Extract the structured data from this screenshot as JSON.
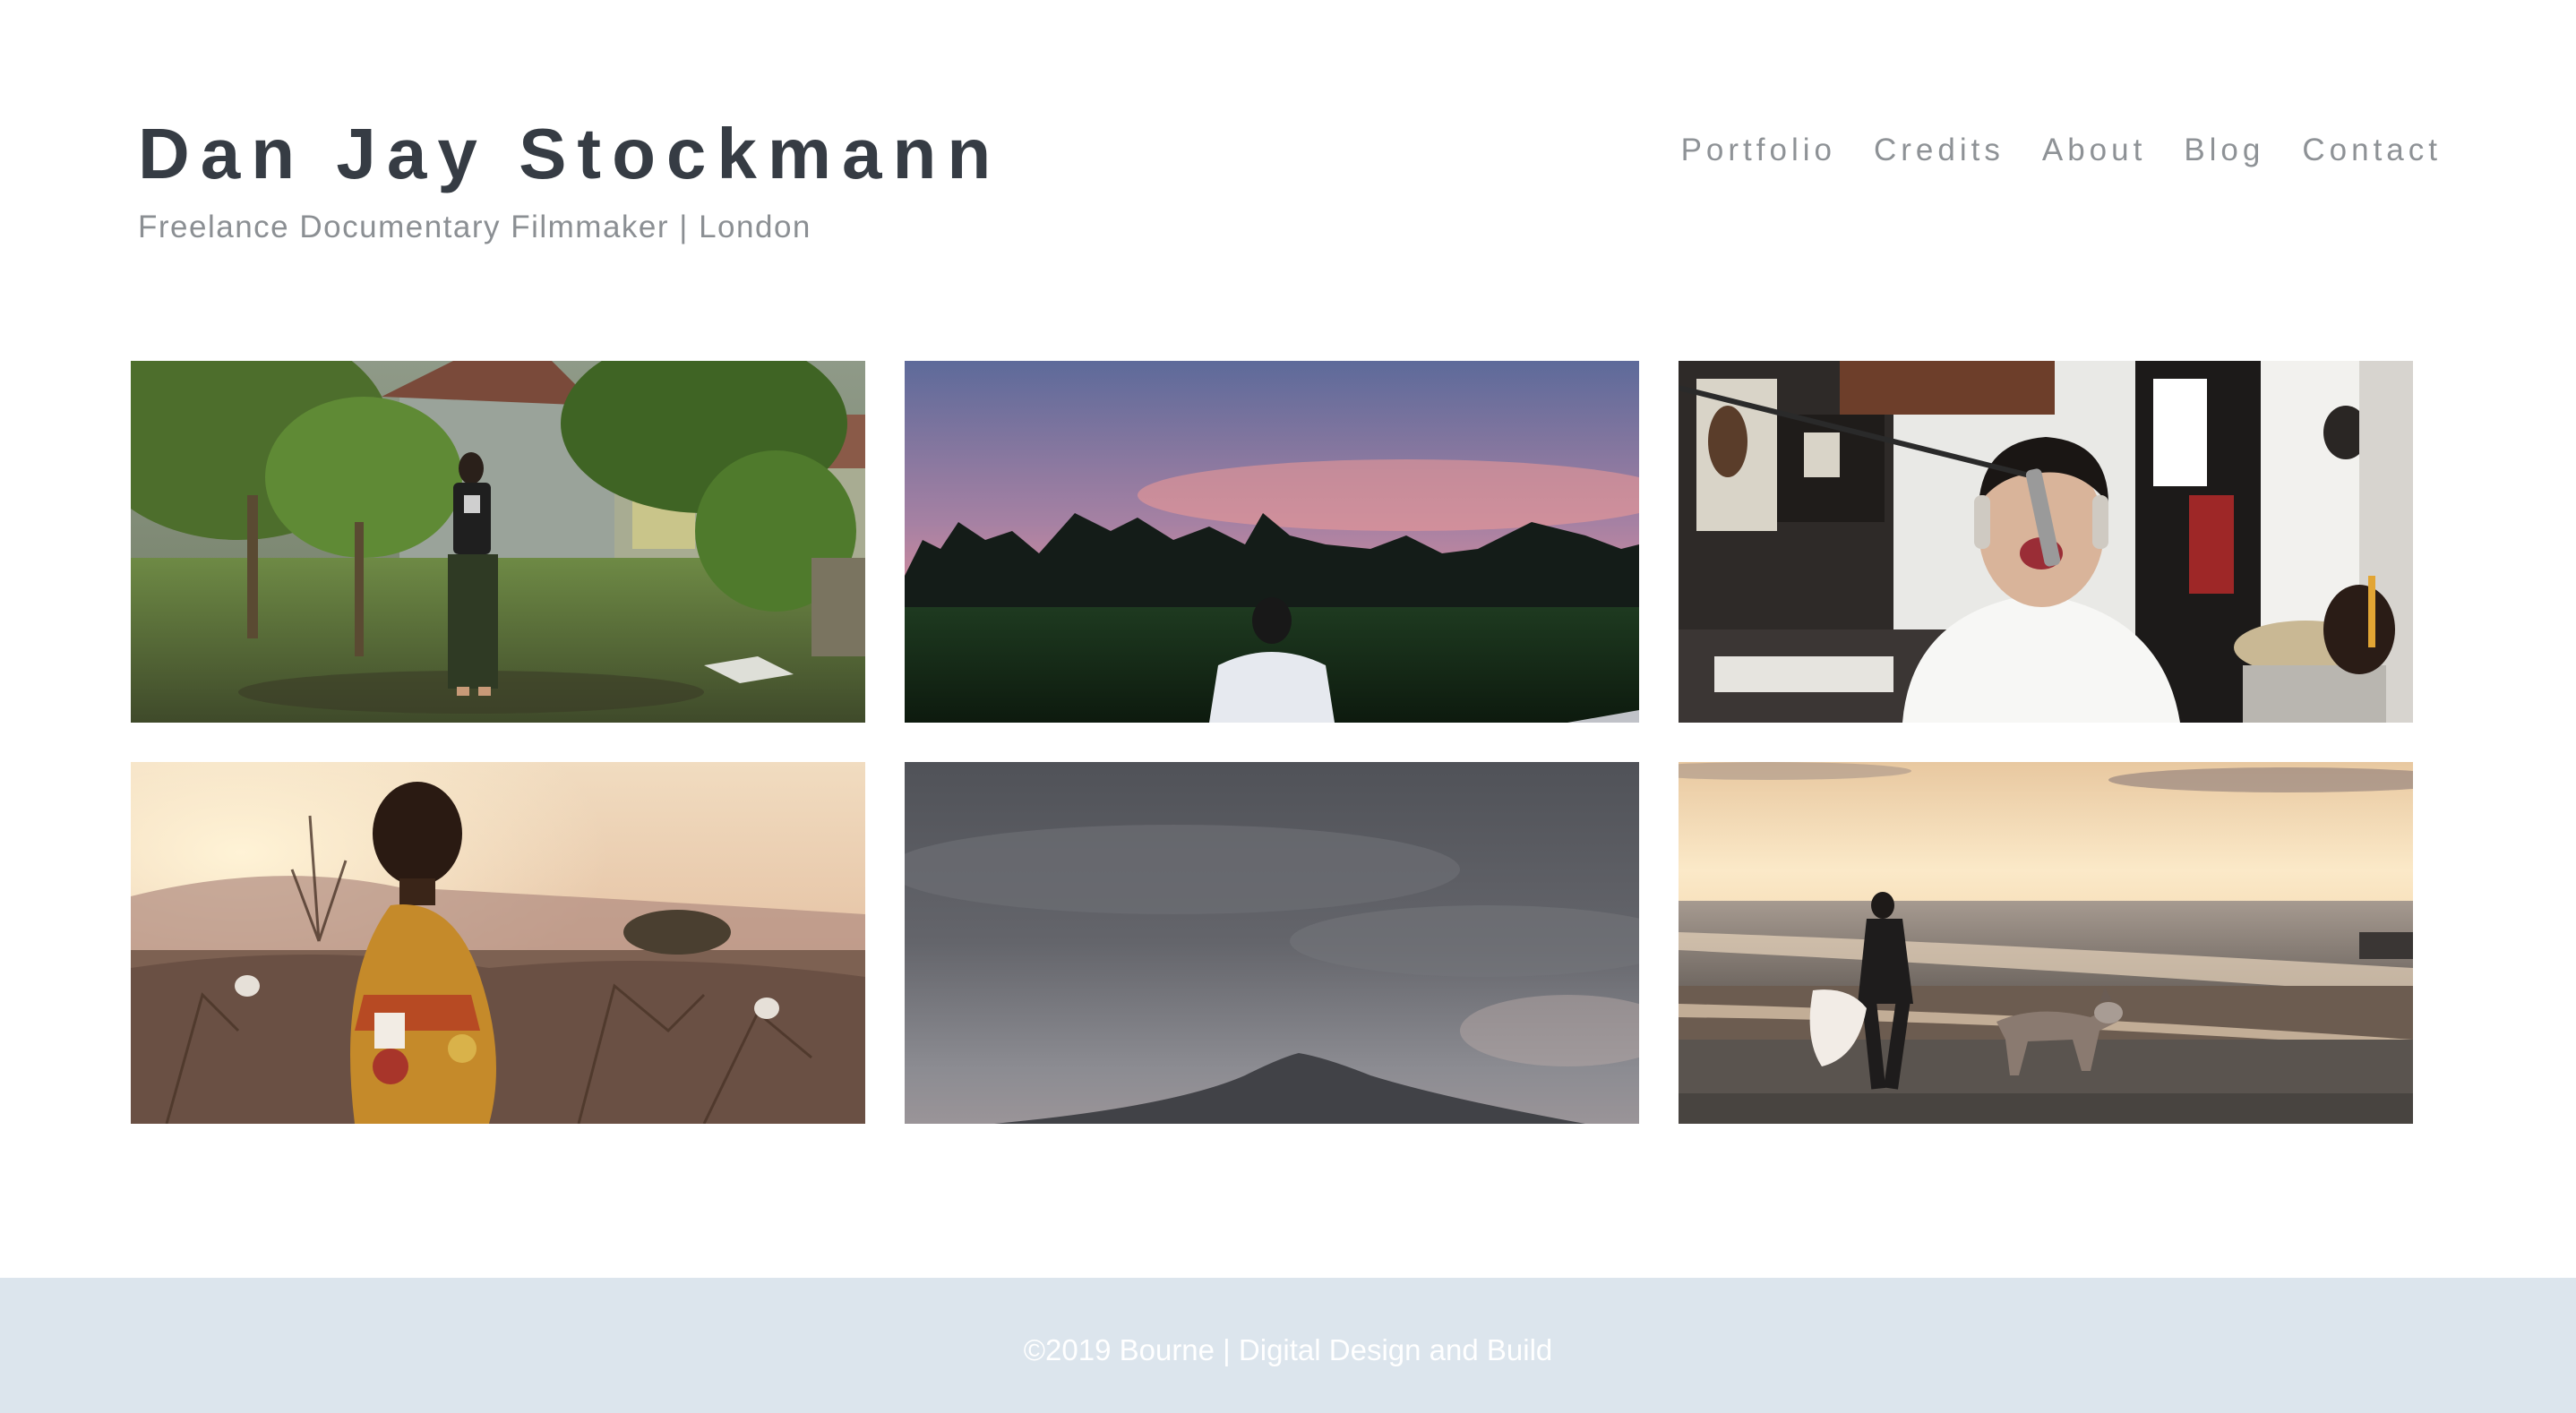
{
  "header": {
    "title": "Dan Jay Stockmann",
    "tagline": "Freelance Documentary Filmmaker | London"
  },
  "nav": {
    "items": [
      {
        "label": "Portfolio"
      },
      {
        "label": "Credits"
      },
      {
        "label": "About"
      },
      {
        "label": "Blog"
      },
      {
        "label": "Contact"
      }
    ]
  },
  "portfolio": {
    "tiles": [
      {
        "subject": "man-standing-in-garden"
      },
      {
        "subject": "man-facing-pink-sunset-field"
      },
      {
        "subject": "singer-at-microphone-in-studio"
      },
      {
        "subject": "child-in-bush-at-sunrise"
      },
      {
        "subject": "grey-sky-over-mountain"
      },
      {
        "subject": "man-walking-dog-on-beach-at-sunset"
      }
    ]
  },
  "footer": {
    "text": "©2019 Bourne | Digital Design and Build"
  }
}
